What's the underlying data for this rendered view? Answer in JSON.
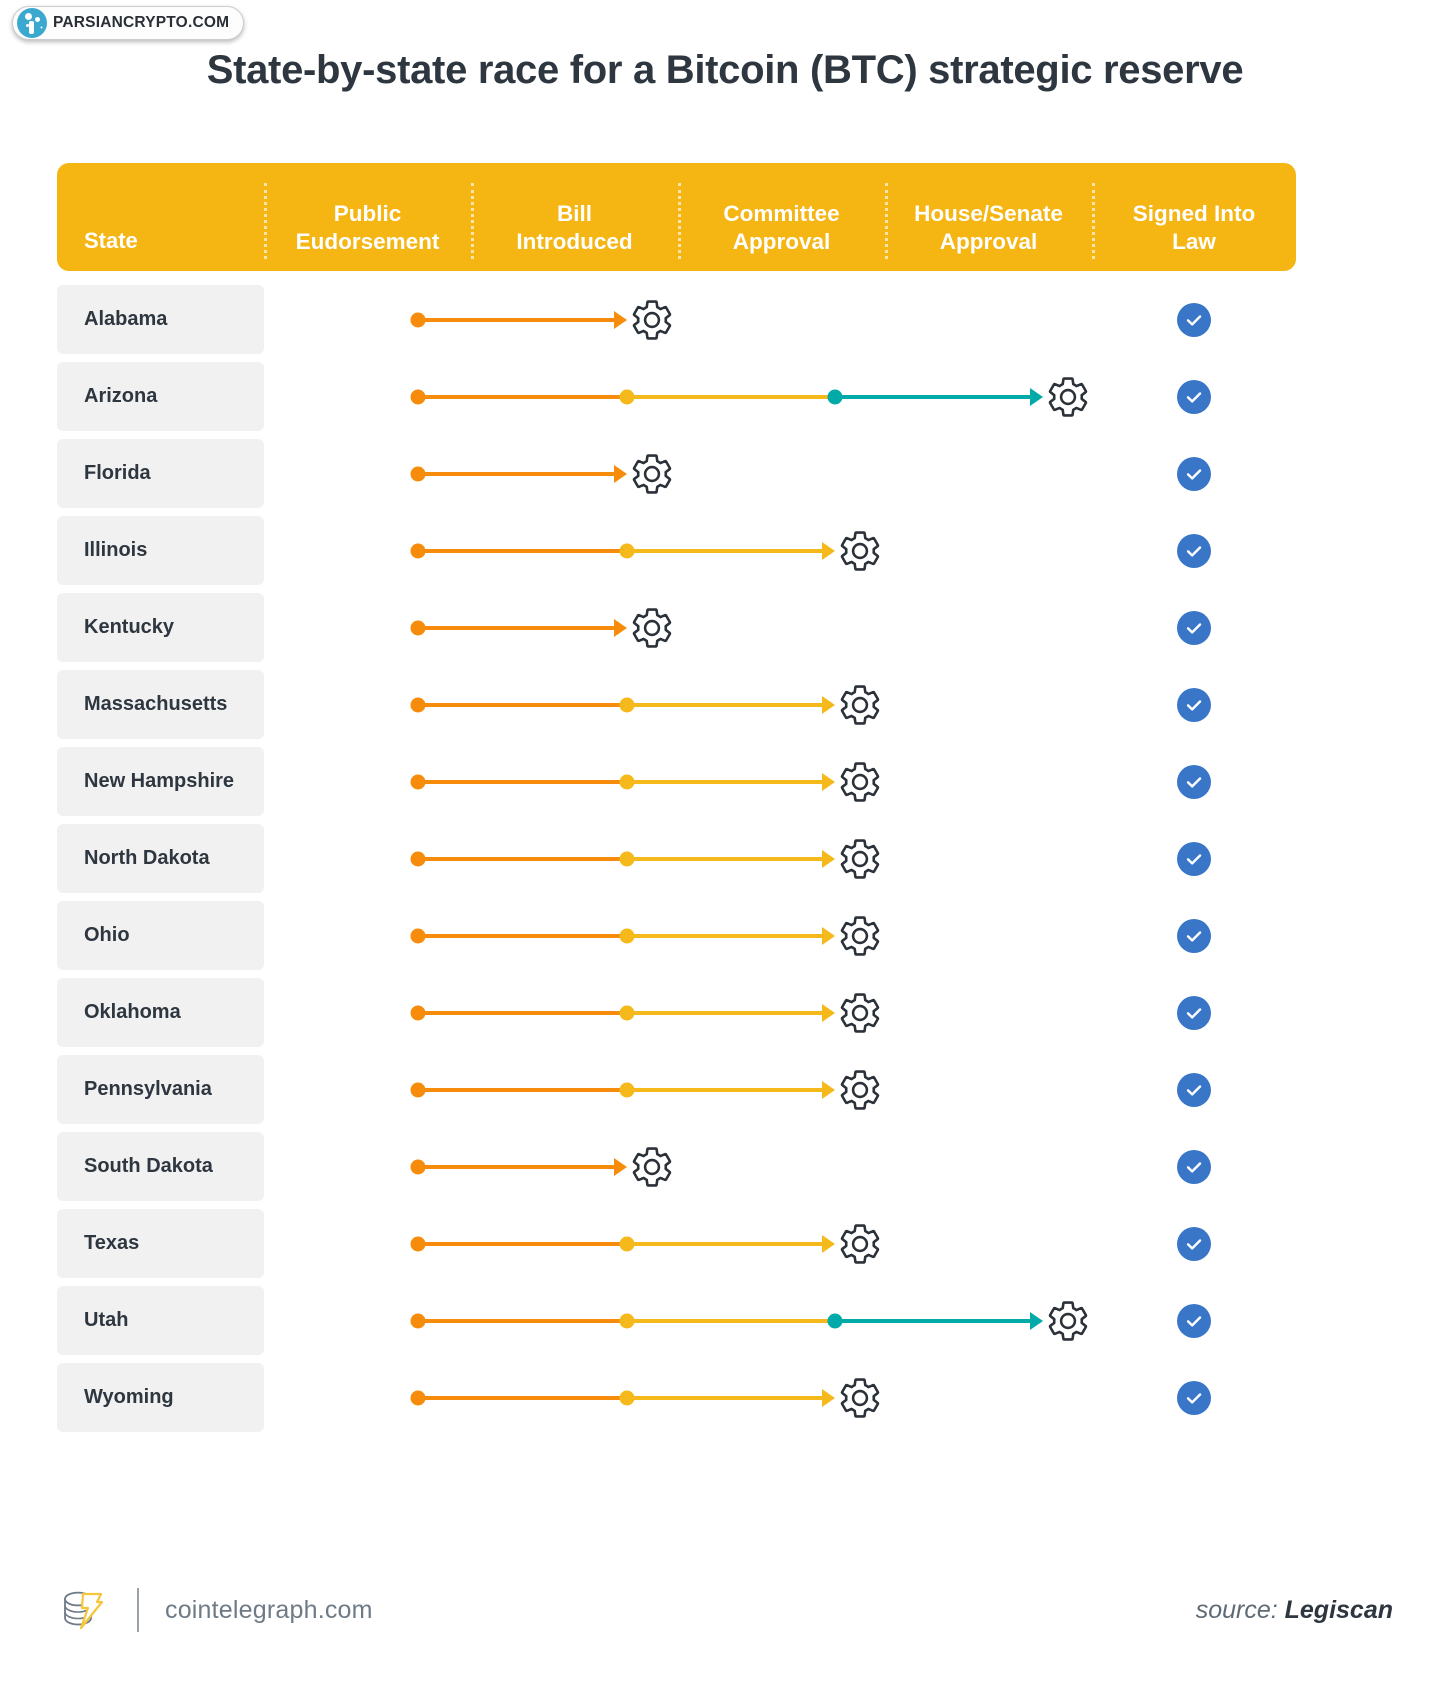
{
  "watermark": {
    "text": "PARSIANCRYPTO.COM",
    "logo_icon": "parsian-crypto-logo-icon"
  },
  "title": "State-by-state race for a Bitcoin (BTC) strategic reserve",
  "colors": {
    "header_bg": "#f5b512",
    "stage1_orange": "#f78c0c",
    "stage2_amber": "#f6b91c",
    "stage3_teal": "#00aaa8",
    "check_blue": "#3a76c8",
    "row_bg": "#f1f1f1",
    "text_dark": "#2e3640"
  },
  "table": {
    "columns": [
      {
        "key": "state",
        "line1": "State",
        "line2": ""
      },
      {
        "key": "endorse",
        "line1": "Public",
        "line2": "Eudorsement"
      },
      {
        "key": "bill",
        "line1": "Bill",
        "line2": "Introduced"
      },
      {
        "key": "comm",
        "line1": "Committee",
        "line2": "Approval"
      },
      {
        "key": "house",
        "line1": "House/Senate",
        "line2": "Approval"
      },
      {
        "key": "signed",
        "line1": "Signed Into",
        "line2": "Law"
      }
    ],
    "rows": [
      {
        "state": "Alabama",
        "stage": 2,
        "signed_into_law": true,
        "status_icon": "gear-icon",
        "check_icon": "check-circle-icon"
      },
      {
        "state": "Arizona",
        "stage": 4,
        "signed_into_law": true,
        "status_icon": "gear-icon",
        "check_icon": "check-circle-icon"
      },
      {
        "state": "Florida",
        "stage": 2,
        "signed_into_law": true,
        "status_icon": "gear-icon",
        "check_icon": "check-circle-icon"
      },
      {
        "state": "Illinois",
        "stage": 3,
        "signed_into_law": true,
        "status_icon": "gear-icon",
        "check_icon": "check-circle-icon"
      },
      {
        "state": "Kentucky",
        "stage": 2,
        "signed_into_law": true,
        "status_icon": "gear-icon",
        "check_icon": "check-circle-icon"
      },
      {
        "state": "Massachusetts",
        "stage": 3,
        "signed_into_law": true,
        "status_icon": "gear-icon",
        "check_icon": "check-circle-icon"
      },
      {
        "state": "New Hampshire",
        "stage": 3,
        "signed_into_law": true,
        "status_icon": "gear-icon",
        "check_icon": "check-circle-icon"
      },
      {
        "state": "North Dakota",
        "stage": 3,
        "signed_into_law": true,
        "status_icon": "gear-icon",
        "check_icon": "check-circle-icon"
      },
      {
        "state": "Ohio",
        "stage": 3,
        "signed_into_law": true,
        "status_icon": "gear-icon",
        "check_icon": "check-circle-icon"
      },
      {
        "state": "Oklahoma",
        "stage": 3,
        "signed_into_law": true,
        "status_icon": "gear-icon",
        "check_icon": "check-circle-icon"
      },
      {
        "state": "Pennsylvania",
        "stage": 3,
        "signed_into_law": true,
        "status_icon": "gear-icon",
        "check_icon": "check-circle-icon"
      },
      {
        "state": "South Dakota",
        "stage": 2,
        "signed_into_law": true,
        "status_icon": "gear-icon",
        "check_icon": "check-circle-icon"
      },
      {
        "state": "Texas",
        "stage": 3,
        "signed_into_law": true,
        "status_icon": "gear-icon",
        "check_icon": "check-circle-icon"
      },
      {
        "state": "Utah",
        "stage": 4,
        "signed_into_law": true,
        "status_icon": "gear-icon",
        "check_icon": "check-circle-icon"
      },
      {
        "state": "Wyoming",
        "stage": 3,
        "signed_into_law": true,
        "status_icon": "gear-icon",
        "check_icon": "check-circle-icon"
      }
    ]
  },
  "footer": {
    "logo_icon": "cointelegraph-logo-icon",
    "site": "cointelegraph.com",
    "source_label": "source:",
    "source_name": "Legiscan"
  }
}
